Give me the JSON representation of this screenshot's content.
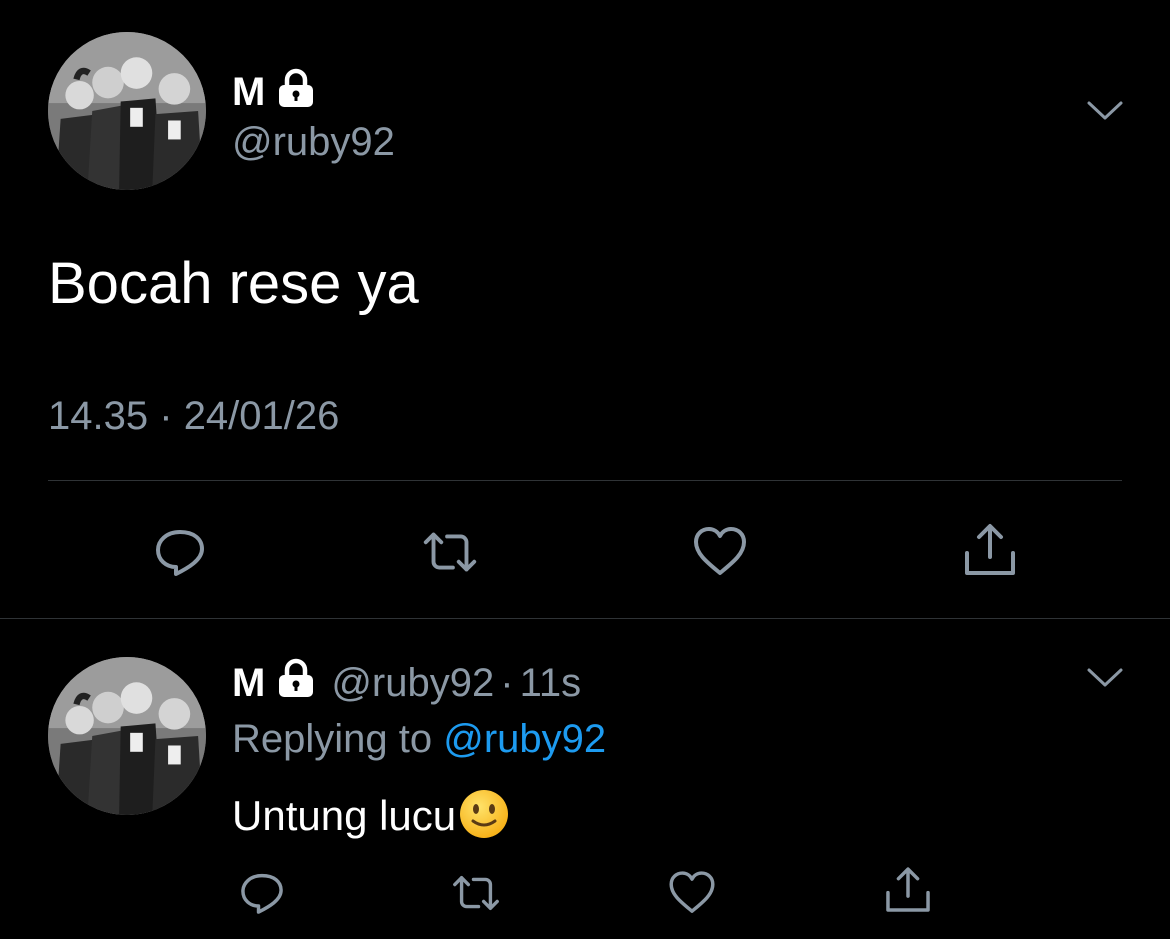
{
  "main_tweet": {
    "name": "M",
    "handle": "@ruby92",
    "text": "Bocah rese ya",
    "time": "14.35",
    "separator": "·",
    "date": "24/01/26"
  },
  "reply_tweet": {
    "name": "M",
    "handle": "@ruby92",
    "separator": "·",
    "age": "11s",
    "replying_label": "Replying to",
    "replying_handle": "@ruby92",
    "text": "Untung lucu",
    "emoji": "slightly-smiling-face"
  },
  "icons": {
    "lock": "lock-icon",
    "menu": "chevron-down-icon",
    "reply": "reply-icon",
    "retweet": "retweet-icon",
    "like": "heart-icon",
    "share": "share-icon"
  },
  "colors": {
    "background": "#000000",
    "text": "#ffffff",
    "muted": "#8b98a5",
    "link": "#1d9bf0",
    "divider": "#2f3336"
  }
}
